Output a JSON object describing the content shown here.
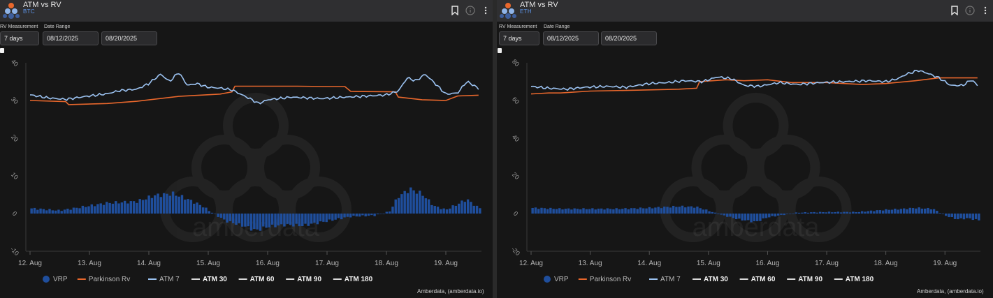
{
  "panels": [
    {
      "header": {
        "title": "ATM vs RV",
        "asset": "BTC"
      },
      "controls": {
        "rv_label": "RV Measurement",
        "date_label": "Date Range",
        "rv_value": "7 days",
        "date_start": "08/12/2025",
        "date_end": "08/20/2025"
      },
      "watermark": "amberdata",
      "credit": "Amberdata, (amberdata.io)"
    },
    {
      "header": {
        "title": "ATM vs RV",
        "asset": "ETH"
      },
      "controls": {
        "rv_label": "RV Measurement",
        "date_label": "Date Range",
        "rv_value": "7 days",
        "date_start": "08/12/2025",
        "date_end": "08/20/2025"
      },
      "watermark": "amberdata",
      "credit": "Amberdata, (amberdata.io)"
    }
  ],
  "icons": [
    "logo-icon",
    "bookmark-icon",
    "info-icon",
    "kebab-menu-icon"
  ],
  "colors": {
    "vrp": "#1f4e9c",
    "parkinson": "#e8672c",
    "atm7": "#9cc3f2",
    "atm_other": "#d9d9d9"
  },
  "chart_data": [
    {
      "type": "line",
      "asset": "BTC",
      "x_ticks": [
        "12. Aug",
        "13. Aug",
        "14. Aug",
        "15. Aug",
        "16. Aug",
        "17. Aug",
        "18. Aug",
        "19. Aug"
      ],
      "x_range": [
        12.0,
        19.6
      ],
      "ylim": [
        -10,
        40
      ],
      "y_ticks": [
        -10,
        0,
        10,
        20,
        30,
        40
      ],
      "legend": [
        "VRP",
        "Parkinson Rv",
        "ATM 7",
        "ATM 30",
        "ATM 60",
        "ATM 90",
        "ATM 180"
      ],
      "legend_placement": "bottom",
      "series": [
        {
          "name": "Parkinson Rv",
          "kind": "line",
          "x": [
            12.0,
            12.6,
            12.65,
            13.3,
            13.8,
            14.5,
            15.2,
            15.4,
            15.45,
            16.5,
            17.0,
            17.3,
            17.4,
            18.15,
            18.2,
            18.6,
            19.0,
            19.2,
            19.55
          ],
          "y": [
            30.0,
            29.7,
            28.9,
            29.2,
            29.8,
            31.1,
            31.7,
            32.3,
            33.8,
            33.8,
            33.7,
            33.7,
            32.4,
            32.3,
            30.9,
            30.2,
            30.0,
            31.2,
            31.4
          ]
        },
        {
          "name": "ATM 7",
          "kind": "line",
          "x": [
            12.0,
            12.3,
            12.6,
            12.9,
            13.3,
            13.5,
            13.8,
            14.0,
            14.2,
            14.35,
            14.5,
            14.65,
            14.8,
            15.0,
            15.2,
            15.4,
            15.7,
            15.85,
            16.0,
            16.4,
            16.9,
            17.2,
            17.7,
            18.0,
            18.2,
            18.35,
            18.5,
            18.65,
            18.8,
            19.0,
            19.2,
            19.35,
            19.5,
            19.55
          ],
          "y": [
            31.5,
            30.7,
            30.3,
            31.0,
            31.8,
            32.6,
            33.0,
            34.5,
            37.0,
            35.0,
            37.5,
            34.0,
            34.5,
            33.5,
            33.3,
            32.8,
            30.5,
            29.2,
            30.2,
            30.9,
            30.5,
            30.8,
            31.2,
            31.5,
            32.5,
            36.0,
            35.2,
            37.0,
            34.8,
            31.7,
            32.0,
            35.0,
            33.8,
            33.0
          ]
        },
        {
          "name": "VRP",
          "kind": "bar",
          "x": [
            12.0,
            12.5,
            12.9,
            13.3,
            13.8,
            14.1,
            14.4,
            14.6,
            14.9,
            15.05,
            15.3,
            15.6,
            15.8,
            16.0,
            16.3,
            16.6,
            17.0,
            17.4,
            17.8,
            18.05,
            18.2,
            18.4,
            18.6,
            18.8,
            19.0,
            19.2,
            19.35,
            19.55
          ],
          "y": [
            1.4,
            0.8,
            1.8,
            2.8,
            3.2,
            4.8,
            5.3,
            4.2,
            2.0,
            0.4,
            -2.0,
            -3.3,
            -4.5,
            -3.5,
            -3.0,
            -3.2,
            -2.0,
            -0.8,
            -0.5,
            0.5,
            4.5,
            6.5,
            5.2,
            2.0,
            1.0,
            2.5,
            3.8,
            1.5
          ]
        }
      ]
    },
    {
      "type": "line",
      "asset": "ETH",
      "x_ticks": [
        "12. Aug",
        "13. Aug",
        "14. Aug",
        "15. Aug",
        "16. Aug",
        "17. Aug",
        "18. Aug",
        "19. Aug"
      ],
      "x_range": [
        12.0,
        19.6
      ],
      "ylim": [
        -20,
        80
      ],
      "y_ticks": [
        -20,
        0,
        20,
        40,
        60,
        80
      ],
      "legend": [
        "VRP",
        "Parkinson Rv",
        "ATM 7",
        "ATM 30",
        "ATM 60",
        "ATM 90",
        "ATM 180"
      ],
      "legend_placement": "bottom",
      "series": [
        {
          "name": "Parkinson Rv",
          "kind": "line",
          "x": [
            12.0,
            12.3,
            12.5,
            13.0,
            13.8,
            14.5,
            14.8,
            14.85,
            15.3,
            15.6,
            16.0,
            16.4,
            16.7,
            17.0,
            17.6,
            18.0,
            18.5,
            18.9,
            19.2,
            19.55
          ],
          "y": [
            63.5,
            64.0,
            64.0,
            65.0,
            65.5,
            66.0,
            66.5,
            70.0,
            71.0,
            70.5,
            71.0,
            69.5,
            69.5,
            69.5,
            68.5,
            69.0,
            70.5,
            72.0,
            72.0,
            72.0
          ]
        },
        {
          "name": "ATM 7",
          "kind": "line",
          "x": [
            12.0,
            12.3,
            12.6,
            12.9,
            13.3,
            13.6,
            14.0,
            14.3,
            14.6,
            14.9,
            15.15,
            15.4,
            15.6,
            15.85,
            16.2,
            16.5,
            16.9,
            17.3,
            17.7,
            18.0,
            18.2,
            18.35,
            18.55,
            18.7,
            18.9,
            19.1,
            19.3,
            19.45,
            19.55
          ],
          "y": [
            67.5,
            66.5,
            66.0,
            67.0,
            67.5,
            67.0,
            69.0,
            69.5,
            70.5,
            70.0,
            72.5,
            71.5,
            68.0,
            67.5,
            69.5,
            68.5,
            69.5,
            70.0,
            70.5,
            70.0,
            71.5,
            74.0,
            76.0,
            74.5,
            72.0,
            68.0,
            68.0,
            71.0,
            68.0
          ]
        },
        {
          "name": "VRP",
          "kind": "bar",
          "x": [
            12.0,
            12.5,
            13.0,
            13.5,
            14.0,
            14.5,
            14.8,
            15.0,
            15.2,
            15.5,
            15.8,
            16.0,
            16.5,
            17.0,
            17.5,
            18.0,
            18.3,
            18.5,
            18.8,
            19.0,
            19.2,
            19.4,
            19.55
          ],
          "y": [
            3.0,
            2.5,
            2.5,
            2.5,
            3.0,
            3.8,
            3.5,
            1.5,
            -0.5,
            -3.0,
            -4.5,
            -2.0,
            0.5,
            0.8,
            0.8,
            2.0,
            2.5,
            3.0,
            2.5,
            -1.0,
            -3.0,
            -2.5,
            -3.5
          ]
        }
      ]
    }
  ]
}
